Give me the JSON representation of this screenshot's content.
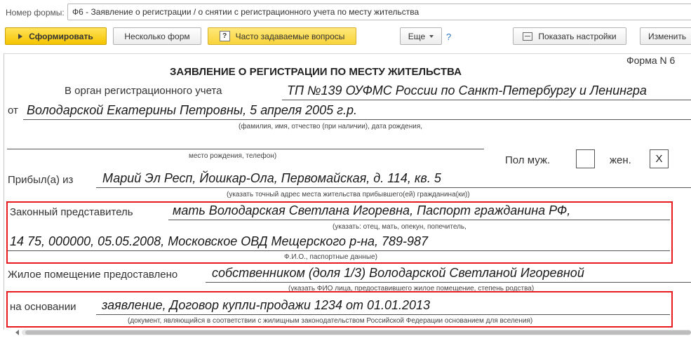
{
  "top": {
    "form_number_label": "Номер формы:",
    "form_number_value": "Ф6 - Заявление о регистрации / о снятии с регистрационного учета по месту жительства"
  },
  "toolbar": {
    "generate": "Сформировать",
    "multiple_forms": "Несколько форм",
    "faq": "Часто задаваемые вопросы",
    "more": "Еще",
    "help": "?",
    "show_settings": "Показать настройки",
    "change": "Изменить"
  },
  "doc": {
    "form_n": "Форма N 6",
    "title": "ЗАЯВЛЕНИЕ О РЕГИСТРАЦИИ ПО МЕСТУ ЖИТЕЛЬСТВА",
    "organ_label": "В орган регистрационного учета",
    "organ_value": "ТП №139 ОУФМС России по Санкт-Петербургу и Ленингра",
    "from_label": "от",
    "from_value": "Володарской  Екатерины Петровны, 5 апреля 2005 г.р.",
    "from_caption": "(фамилия, имя, отчество (при наличии), дата рождения,",
    "birthplace_caption": "место рождения, телефон)",
    "sex_label": "Пол муж.",
    "sex_female_label": "жен.",
    "sex_male_mark": "",
    "sex_female_mark": "X",
    "arrived_label": "Прибыл(а) из",
    "arrived_value": "Марий Эл Респ, Йошкар-Ола, Первомайская, д. 114, кв. 5",
    "arrived_caption": "(указать точный адрес места жительства прибывшего(ей) гражданина(ки))",
    "rep_label": "Законный представитель",
    "rep_value1": "мать Володарская Светлана Игоревна, Паспорт гражданина РФ,",
    "rep_caption1": "(указать: отец, мать, опекун, попечитель,",
    "rep_value2": "14 75, 000000, 05.05.2008, Московское ОВД Мещерского р-на, 789-987",
    "rep_caption2": "Ф.И.О., паспортные данные)",
    "premises_label": "Жилое помещение предоставлено",
    "premises_value": "собственником (доля 1/3) Володарской Светланой Игоревной",
    "premises_caption": "(указать ФИО лица, предоставившего жилое помещение, степень родства)",
    "basis_label": "на основании",
    "basis_value": "заявление, Договор купли-продажи 1234 от 01.01.2013",
    "basis_caption": "(документ, являющийся в соответствии с жилищным законодательством Российской Федерации основанием для вселения)"
  },
  "colors": {
    "accent_yellow": "#f5c400",
    "highlight_red": "#e8191f",
    "link_blue": "#2b74c7"
  },
  "icons": [
    "play-icon",
    "question-icon",
    "chevron-down-icon",
    "settings-icon"
  ]
}
